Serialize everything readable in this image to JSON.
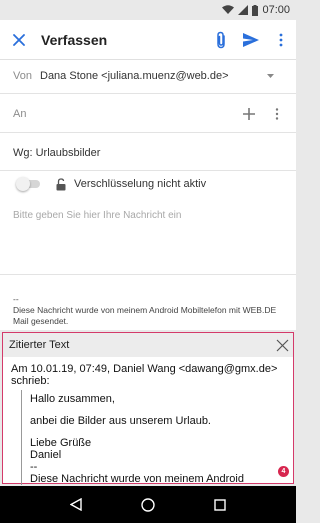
{
  "status": {
    "time": "07:00"
  },
  "appbar": {
    "title": "Verfassen"
  },
  "from": {
    "label": "Von",
    "value": "Dana Stone <juliana.muenz@web.de>"
  },
  "to": {
    "label": "An"
  },
  "subject": {
    "value": "Wg: Urlaubsbilder"
  },
  "encryption": {
    "label": "Verschlüsselung nicht aktiv",
    "enabled": false
  },
  "body": {
    "placeholder": "Bitte geben Sie hier Ihre Nachricht ein",
    "signature_dash": "--",
    "signature_text": "Diese Nachricht wurde von meinem Android Mobiltelefon mit WEB.DE Mail gesendet."
  },
  "quote": {
    "title": "Zitierter Text",
    "header": "Am 10.01.19, 07:49, Daniel Wang <dawang@gmx.de> schrieb:",
    "greeting": "Hallo zusammen,",
    "line1": "anbei die Bilder aus unserem Urlaub.",
    "closing1": "Liebe Grüße",
    "closing2": "Daniel",
    "dash": "--",
    "sig": "Diese Nachricht wurde von meinem Android",
    "badge": "4"
  },
  "colors": {
    "accent": "#2a6fdb",
    "quote_border": "#d43a6a",
    "badge": "#d7264f"
  }
}
